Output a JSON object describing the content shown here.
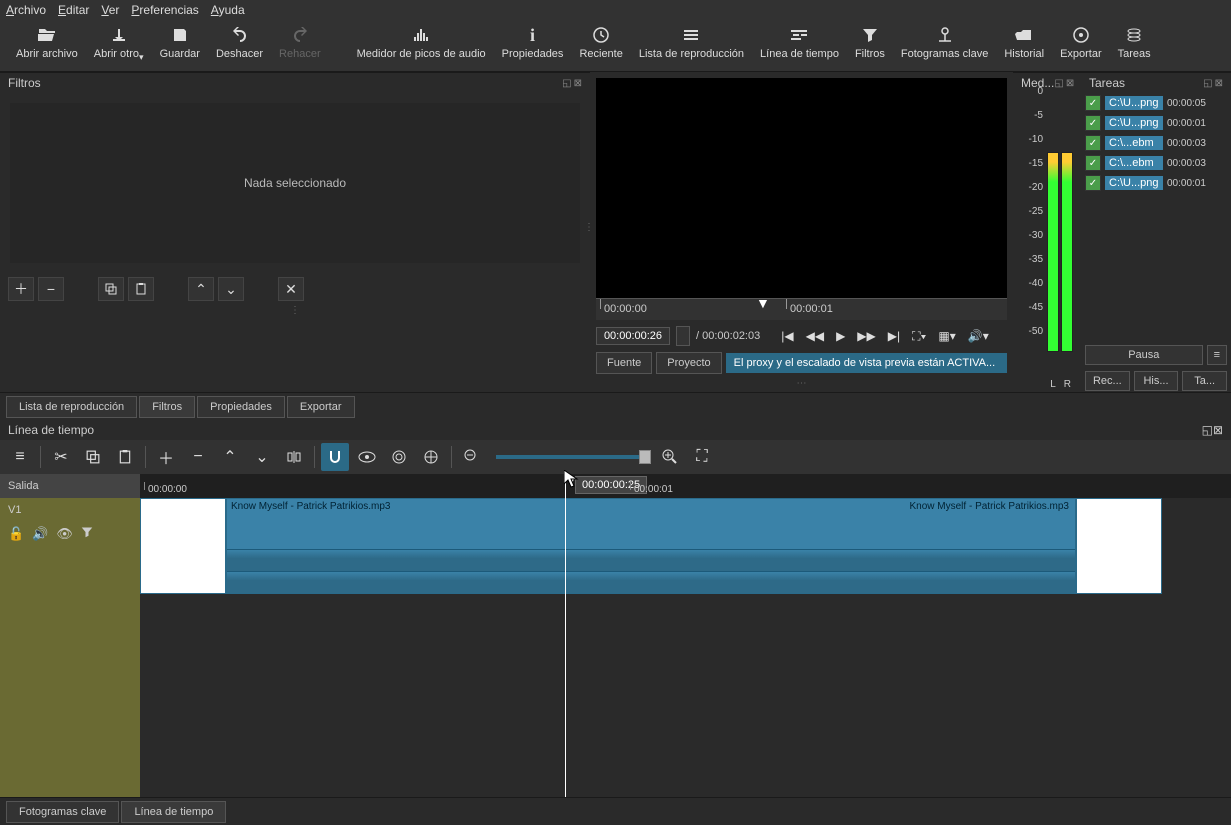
{
  "menu": {
    "items": [
      "Archivo",
      "Editar",
      "Ver",
      "Preferencias",
      "Ayuda"
    ]
  },
  "toolbar": [
    {
      "id": "open",
      "label": "Abrir archivo"
    },
    {
      "id": "open-other",
      "label": "Abrir otro"
    },
    {
      "id": "save",
      "label": "Guardar"
    },
    {
      "id": "undo",
      "label": "Deshacer"
    },
    {
      "id": "redo",
      "label": "Rehacer",
      "disabled": true
    },
    {
      "id": "peak",
      "label": "Medidor de picos de audio"
    },
    {
      "id": "props",
      "label": "Propiedades"
    },
    {
      "id": "recent",
      "label": "Reciente"
    },
    {
      "id": "playlist",
      "label": "Lista de reproducción"
    },
    {
      "id": "timeline",
      "label": "Línea de tiempo"
    },
    {
      "id": "filters",
      "label": "Filtros"
    },
    {
      "id": "keyframes",
      "label": "Fotogramas clave"
    },
    {
      "id": "history",
      "label": "Historial"
    },
    {
      "id": "export",
      "label": "Exportar"
    },
    {
      "id": "jobs",
      "label": "Tareas"
    }
  ],
  "filters": {
    "title": "Filtros",
    "empty": "Nada seleccionado"
  },
  "preview": {
    "ruler_t0": "00:00:00",
    "ruler_t1": "00:00:01",
    "tc": "00:00:00:26",
    "total": "/ 00:00:02:03",
    "tab_source": "Fuente",
    "tab_project": "Proyecto",
    "proxy": "El proxy y el escalado de vista previa están ACTIVA..."
  },
  "meter": {
    "title": "Med...",
    "scale": [
      "0",
      "-5",
      "-10",
      "-15",
      "-20",
      "-25",
      "-30",
      "-35",
      "-40",
      "-45",
      "-50"
    ],
    "L": "L",
    "R": "R"
  },
  "jobs": {
    "title": "Tareas",
    "rows": [
      {
        "path": "C:\\U...png",
        "time": "00:00:05"
      },
      {
        "path": "C:\\U...png",
        "time": "00:00:01"
      },
      {
        "path": "C:\\...ebm",
        "time": "00:00:03"
      },
      {
        "path": "C:\\...ebm",
        "time": "00:00:03"
      },
      {
        "path": "C:\\U...png",
        "time": "00:00:01"
      }
    ],
    "pause": "Pausa",
    "btns": [
      "Rec...",
      "His...",
      "Ta..."
    ]
  },
  "mid_tabs": [
    "Lista de reproducción",
    "Filtros",
    "Propiedades",
    "Exportar"
  ],
  "timeline": {
    "title": "Línea de tiempo",
    "salida": "Salida",
    "track": "V1",
    "ruler_t0": "00:00:00",
    "ruler_t1": "00:00:01",
    "tooltip": "00:00:00:25",
    "clip": "Know Myself - Patrick Patrikios.mp3"
  },
  "bottom_tabs": [
    "Fotogramas clave",
    "Línea de tiempo"
  ]
}
